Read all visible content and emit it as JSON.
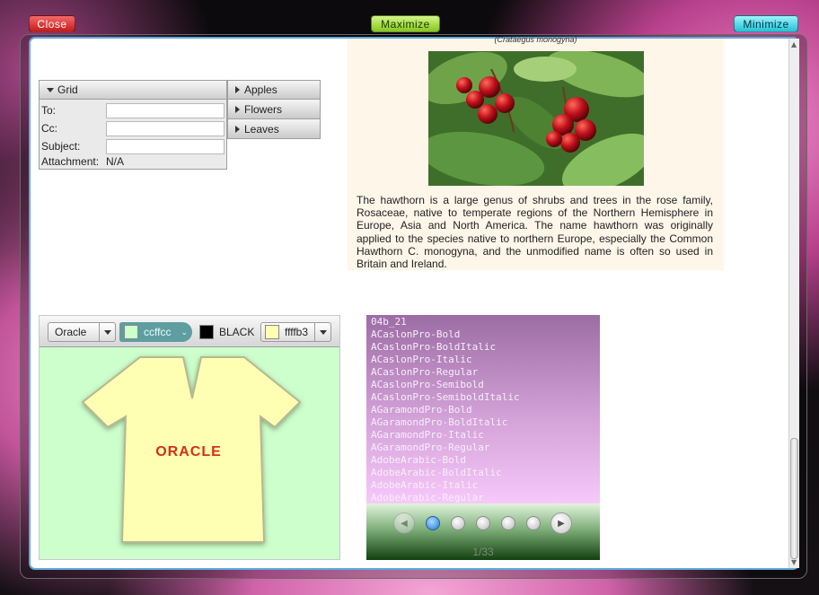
{
  "window_controls": {
    "close": "Close",
    "maximize": "Maximize",
    "minimize": "Minimize"
  },
  "form": {
    "title": "Grid",
    "to_label": "To:",
    "cc_label": "Cc:",
    "subject_label": "Subject:",
    "attachment_label": "Attachment:",
    "attachment_value": "N/A",
    "to_value": "",
    "cc_value": "",
    "subject_value": ""
  },
  "accordion": {
    "items": [
      "Apples",
      "Flowers",
      "Leaves"
    ]
  },
  "article": {
    "caption": "(Crataegus monogyna)",
    "body": "The hawthorn is a large genus of shrubs and trees in the rose family, Rosaceae, native to temperate regions of the Northern Hemisphere in Europe, Asia and North America. The name hawthorn was originally applied to the species native to northern Europe, especially the Common Hawthorn C. monogyna, and the unmodified name is often so used in Britain and Ireland."
  },
  "tshirt": {
    "font_combo": "Oracle",
    "shirt_color_combo": "ccffcc",
    "text_color_combo": "BLACK",
    "background_combo": "ffffb3",
    "logo_text": "ORACLE",
    "colors": {
      "panel_bg": "#ccffcc",
      "shirt": "#ffffb3",
      "logo": "#d62e1a"
    }
  },
  "font_list": {
    "items": [
      "04b_21",
      "ACaslonPro-Bold",
      "ACaslonPro-BoldItalic",
      "ACaslonPro-Italic",
      "ACaslonPro-Regular",
      "ACaslonPro-Semibold",
      "ACaslonPro-SemiboldItalic",
      "AGaramondPro-Bold",
      "AGaramondPro-BoldItalic",
      "AGaramondPro-Italic",
      "AGaramondPro-Regular",
      "AdobeArabic-Bold",
      "AdobeArabic-BoldItalic",
      "AdobeArabic-Italic",
      "AdobeArabic-Regular"
    ],
    "page_indicator": "1/33",
    "visible_page_dots": 5,
    "active_dot": 0
  }
}
